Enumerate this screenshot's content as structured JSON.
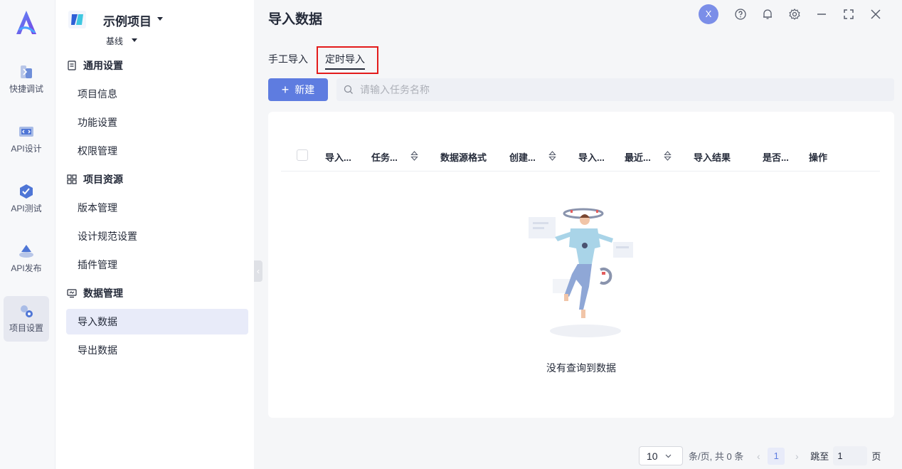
{
  "rail": {
    "items": [
      {
        "label": "快捷调试",
        "icon": "quick-debug-icon"
      },
      {
        "label": "API设计",
        "icon": "api-design-icon"
      },
      {
        "label": "API测试",
        "icon": "api-test-icon"
      },
      {
        "label": "API发布",
        "icon": "api-publish-icon"
      },
      {
        "label": "项目设置",
        "icon": "project-settings-icon",
        "active": true
      }
    ]
  },
  "sidebar": {
    "project_name": "示例项目",
    "branch": "基线",
    "groups": [
      {
        "title": "通用设置",
        "items": [
          "项目信息",
          "功能设置",
          "权限管理"
        ]
      },
      {
        "title": "项目资源",
        "items": [
          "版本管理",
          "设计规范设置",
          "插件管理"
        ]
      },
      {
        "title": "数据管理",
        "items": [
          "导入数据",
          "导出数据"
        ]
      }
    ],
    "active_item": "导入数据"
  },
  "header": {
    "title": "导入数据",
    "avatar_initial": "X"
  },
  "tabs": [
    {
      "label": "手工导入"
    },
    {
      "label": "定时导入",
      "active": true
    }
  ],
  "toolbar": {
    "new_label": "新建",
    "search_placeholder": "请输入任务名称"
  },
  "table": {
    "columns": [
      "导入...",
      "任务...",
      "数据源格式",
      "创建...",
      "导入...",
      "最近...",
      "导入结果",
      "是否...",
      "操作"
    ],
    "empty_text": "没有查询到数据"
  },
  "pagination": {
    "page_size": "10",
    "summary": "条/页, 共 0 条",
    "current_page": "1",
    "jump_label": "跳至",
    "jump_value": "1",
    "page_suffix": "页"
  },
  "colors": {
    "primary": "#5e7ce0",
    "highlight": "#e31b1b",
    "active_bg": "#e8ebf9"
  }
}
